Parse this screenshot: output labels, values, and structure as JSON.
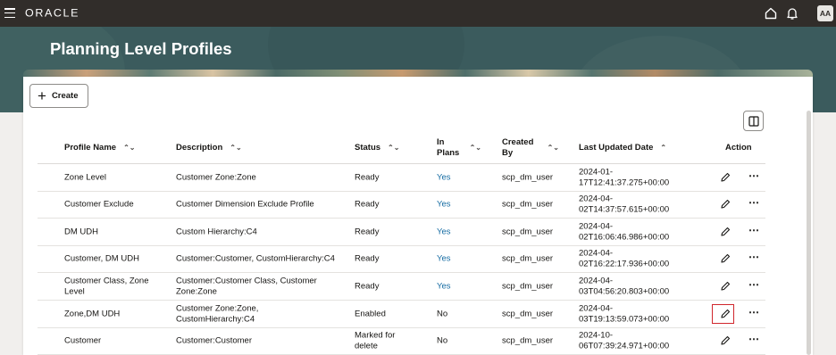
{
  "app": {
    "logo": "ORACLE",
    "avatar_initials": "AA"
  },
  "page": {
    "title": "Planning Level Profiles"
  },
  "toolbar": {
    "create_label": "Create"
  },
  "table": {
    "headers": {
      "profile_name": "Profile Name",
      "description": "Description",
      "status": "Status",
      "in_plans": "In Plans",
      "created_by": "Created By",
      "last_updated": "Last Updated Date",
      "action": "Action"
    },
    "rows": [
      {
        "profile_name": "Zone Level",
        "description": "Customer Zone:Zone",
        "status": "Ready",
        "in_plans": "Yes",
        "created_by": "scp_dm_user",
        "last_updated": "2024-01-17T12:41:37.275+00:00"
      },
      {
        "profile_name": "Customer Exclude",
        "description": "Customer Dimension Exclude Profile",
        "status": "Ready",
        "in_plans": "Yes",
        "created_by": "scp_dm_user",
        "last_updated": "2024-04-02T14:37:57.615+00:00"
      },
      {
        "profile_name": "DM UDH",
        "description": "Custom Hierarchy:C4",
        "status": "Ready",
        "in_plans": "Yes",
        "created_by": "scp_dm_user",
        "last_updated": "2024-04-02T16:06:46.986+00:00"
      },
      {
        "profile_name": "Customer, DM UDH",
        "description": "Customer:Customer, CustomHierarchy:C4",
        "status": "Ready",
        "in_plans": "Yes",
        "created_by": "scp_dm_user",
        "last_updated": "2024-04-02T16:22:17.936+00:00"
      },
      {
        "profile_name": "Customer Class, Zone Level",
        "description": "Customer:Customer Class, Customer Zone:Zone",
        "status": "Ready",
        "in_plans": "Yes",
        "created_by": "scp_dm_user",
        "last_updated": "2024-04-03T04:56:20.803+00:00"
      },
      {
        "profile_name": "Zone,DM UDH",
        "description": "Customer Zone:Zone, CustomHierarchy:C4",
        "status": "Enabled",
        "in_plans": "No",
        "created_by": "scp_dm_user",
        "last_updated": "2024-04-03T19:13:59.073+00:00"
      },
      {
        "profile_name": "Customer",
        "description": "Customer:Customer",
        "status": "Marked for delete",
        "in_plans": "No",
        "created_by": "scp_dm_user",
        "last_updated": "2024-10-06T07:39:24.971+00:00"
      }
    ]
  },
  "colors": {
    "topbar": "#312d2a",
    "hero": "#3b5b5d",
    "link": "#166ca3",
    "highlight": "#d0262c"
  },
  "icons": [
    "menu-icon",
    "home-icon",
    "bell-icon",
    "plus-icon",
    "columns-icon",
    "sort-icon",
    "sort-ascending-icon",
    "edit-icon",
    "more-icon"
  ]
}
